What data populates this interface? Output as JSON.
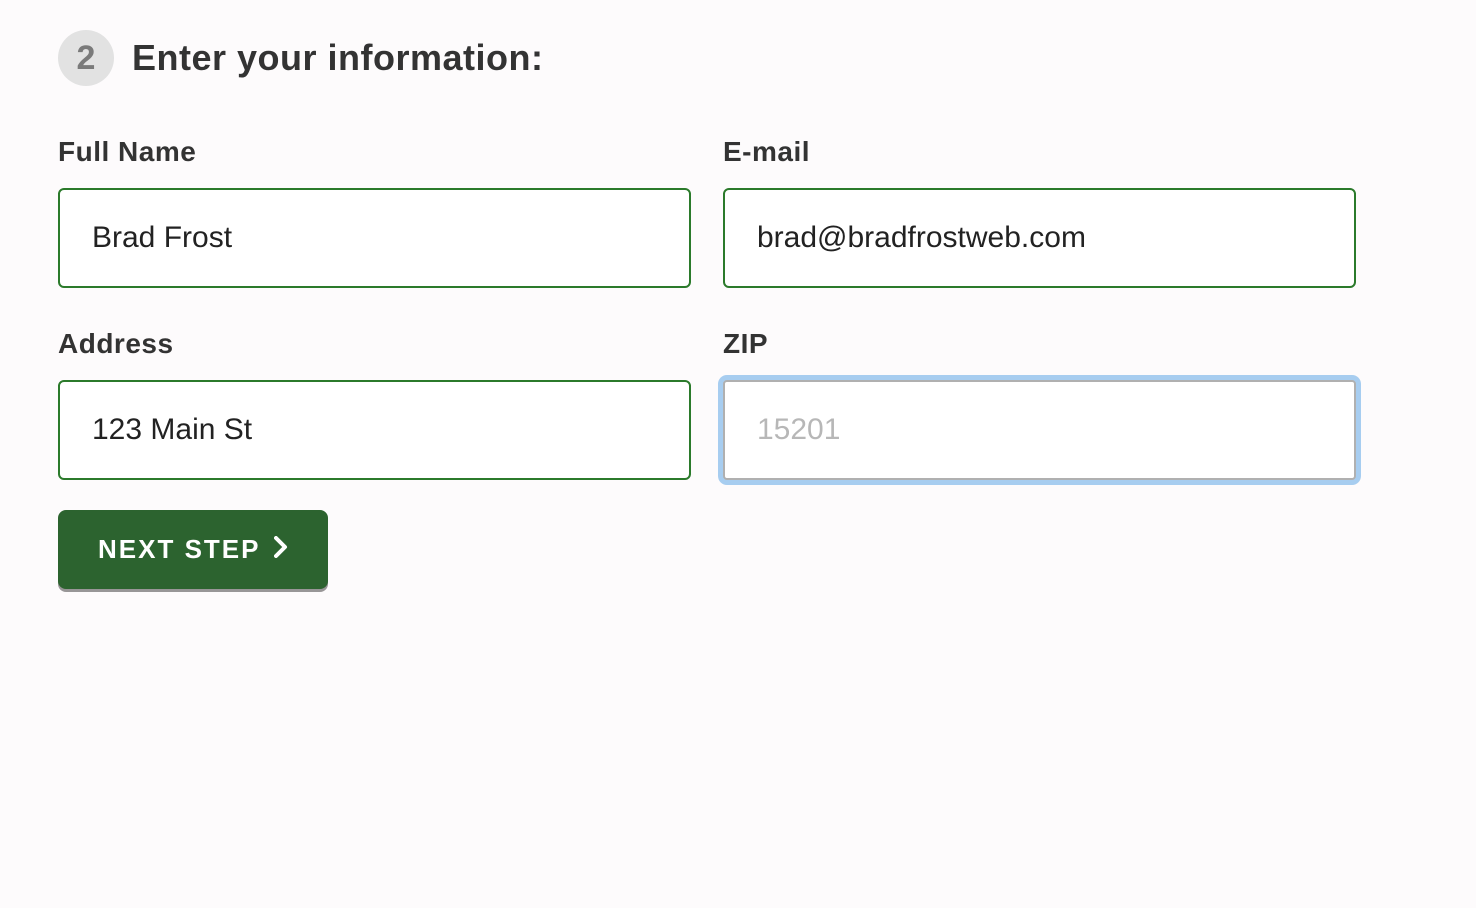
{
  "step": {
    "number": "2",
    "title": "Enter your information:"
  },
  "fields": {
    "full_name": {
      "label": "Full Name",
      "value": "Brad Frost"
    },
    "email": {
      "label": "E-mail",
      "value": "brad@bradfrostweb.com"
    },
    "address": {
      "label": "Address",
      "value": "123 Main St"
    },
    "zip": {
      "label": "ZIP",
      "value": "",
      "placeholder": "15201"
    }
  },
  "button": {
    "label": "NEXT STEP"
  }
}
